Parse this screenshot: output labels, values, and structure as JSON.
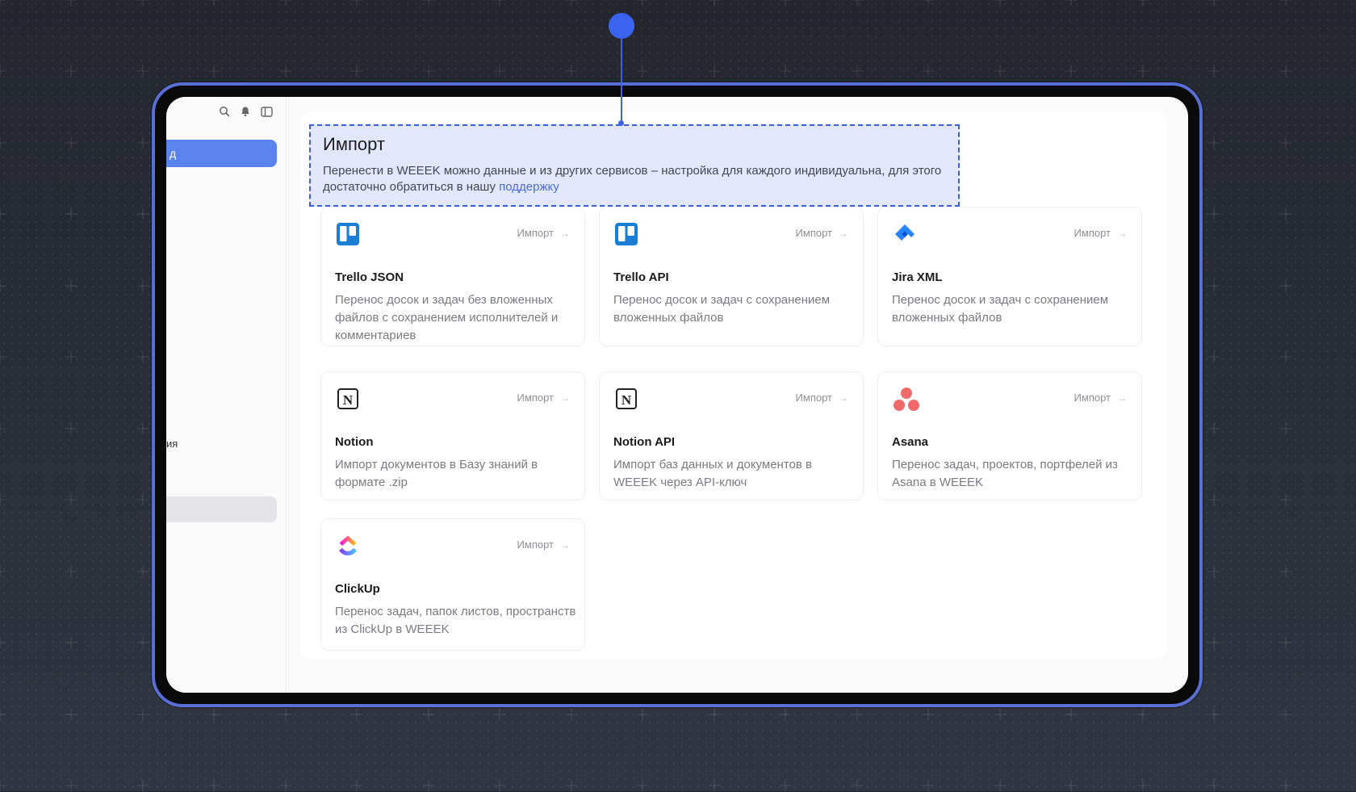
{
  "sidebar": {
    "active_item_label": "д",
    "partial_text": "ия"
  },
  "header": {
    "title": "Импорт",
    "description": "Перенести в WEEEK можно данные и из других сервисов – настройка для каждого индивидуальна, для этого достаточно обратиться в нашу",
    "support_link": "поддержку"
  },
  "cards": [
    {
      "title": "Trello JSON",
      "desc": "Перенос досок и задач без вложенных файлов с сохранением исполнителей и комментариев",
      "action": "Импорт",
      "icon": "trello-icon"
    },
    {
      "title": "Trello API",
      "desc": "Перенос досок и задач с сохранением вложенных файлов",
      "action": "Импорт",
      "icon": "trello-icon"
    },
    {
      "title": "Jira XML",
      "desc": "Перенос досок и задач с сохранением вложенных файлов",
      "action": "Импорт",
      "icon": "jira-icon"
    },
    {
      "title": "Notion",
      "desc": "Импорт документов в Базу знаний в формате .zip",
      "action": "Импорт",
      "icon": "notion-icon"
    },
    {
      "title": "Notion API",
      "desc": "Импорт баз данных и документов в WEEEK через API-ключ",
      "action": "Импорт",
      "icon": "notion-icon"
    },
    {
      "title": "Asana",
      "desc": "Перенос задач, проектов, портфелей из Asana в WEEEK",
      "action": "Импорт",
      "icon": "asana-icon"
    },
    {
      "title": "ClickUp",
      "desc": "Перенос задач, папок листов, пространств из ClickUp в WEEEK",
      "action": "Импорт",
      "icon": "clickup-icon"
    }
  ],
  "colors": {
    "accent": "#3a64f0",
    "device_frame": "#5a6fd6",
    "trello": "#1a7fd4",
    "jira": "#2684ff",
    "asana": "#f06a6a"
  }
}
